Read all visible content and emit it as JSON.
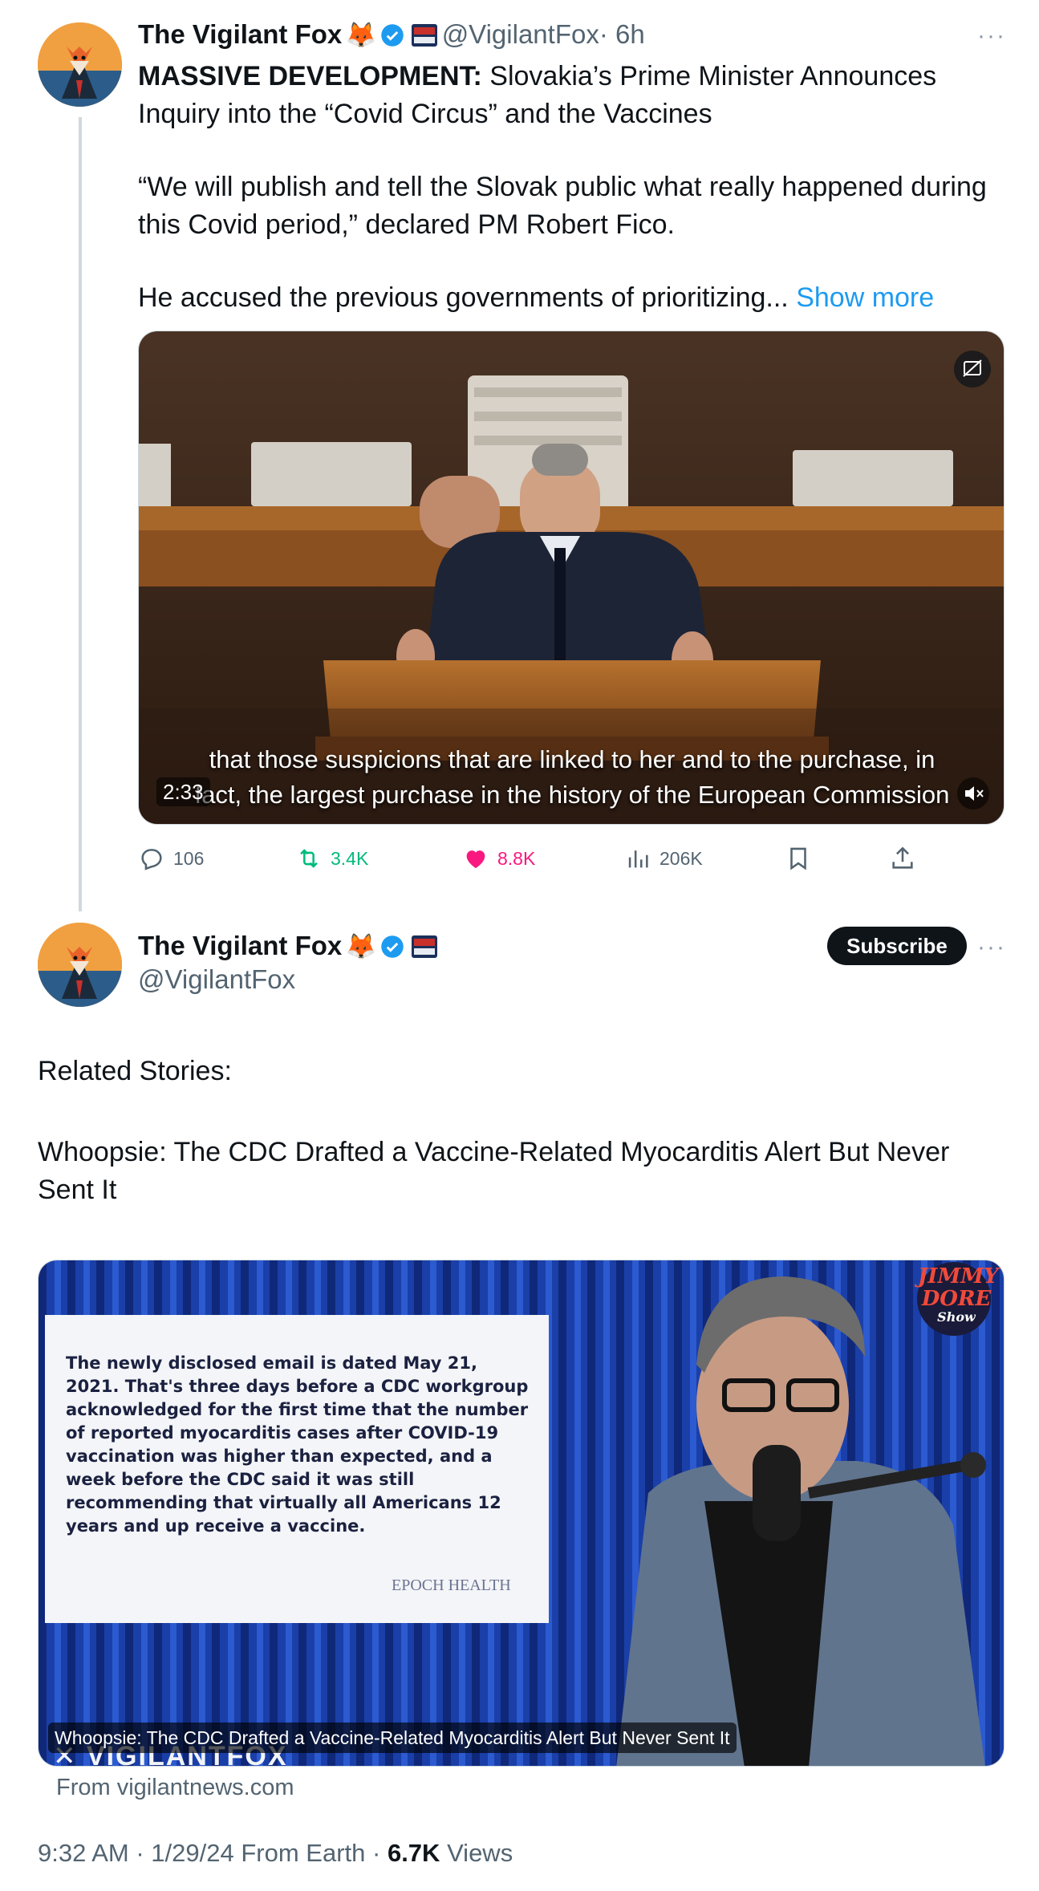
{
  "tweet1": {
    "display_name": "The Vigilant Fox",
    "emoji": "🦊",
    "handle": "@VigilantFox",
    "time": "· 6h",
    "more": "···",
    "lead_bold": "MASSIVE DEVELOPMENT:",
    "lead_rest": " Slovakia’s Prime Minister Announces Inquiry into the “Covid Circus” and the Vaccines",
    "para2": "“We will publish and tell the Slovak public what really happened during this Covid period,” declared PM Robert Fico.",
    "para3": "He accused the previous governments of prioritizing...",
    "show_more": "Show more",
    "video": {
      "caption_line1": "that those suspicions that are linked to her and to the purchase, in",
      "caption_line2": "fact, the largest purchase in the history of the European Commission",
      "duration": "2:33"
    },
    "actions": {
      "replies": "106",
      "reposts": "3.4K",
      "likes": "8.8K",
      "views": "206K"
    },
    "colors": {
      "repost": "#00ba7c",
      "like": "#f91880",
      "link": "#1d9bf0"
    }
  },
  "tweet2": {
    "display_name": "The Vigilant Fox",
    "emoji": "🦊",
    "handle": "@VigilantFox",
    "subscribe": "Subscribe",
    "more": "···",
    "related": "Related Stories:",
    "story_title": "Whoopsie: The CDC Drafted a Vaccine-Related Myocarditis Alert But Never Sent It",
    "card": {
      "slide_text": "The newly disclosed email is dated May 21, 2021. That's three days before a CDC workgroup acknowledged for the first time that the number of reported myocarditis cases after COVID-19 vaccination was higher than expected, and a week before the CDC said it was still recommending that virtually all Americans 12 years and up receive a vaccine.",
      "slide_source": "EPOCH HEALTH",
      "show_logo_line1": "JIMMY",
      "show_logo_line2": "DORE",
      "show_logo_line3": "Show",
      "watermark": "VIGILANTFOX",
      "overlay_title": "Whoopsie: The CDC Drafted a Vaccine-Related Myocarditis Alert But Never Sent It",
      "from": "From vigilantnews.com"
    },
    "footer": {
      "time": "9:32 AM",
      "date": "· 1/29/24 From Earth ·",
      "views_count": "6.7K",
      "views_label": "Views"
    }
  }
}
